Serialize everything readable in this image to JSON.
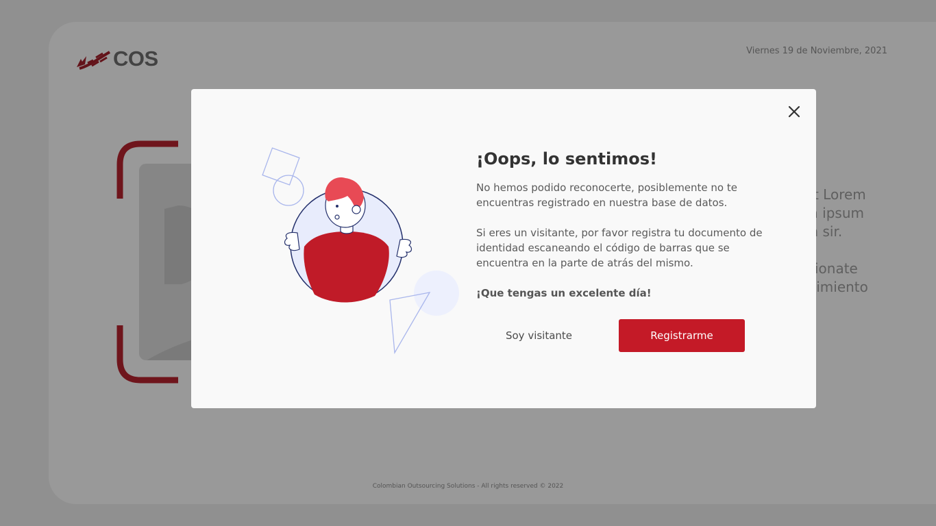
{
  "brand": {
    "logo_text": "COS"
  },
  "header": {
    "date": "Viernes 19 de Noviembre, 2021"
  },
  "background_text": {
    "paragraph1": [
      "net Lorem",
      "em ipsum",
      "um sir."
    ],
    "paragraph2": [
      "sicionate",
      "nicimiento"
    ]
  },
  "footer": {
    "text": "Colombian Outsourcing Solutions - All rights reserved © 2022"
  },
  "modal": {
    "title": "¡Oops, lo sentimos!",
    "message1": "No hemos podido reconocerte, posiblemente no te encuentras registrado en nuestra base de datos.",
    "message2": "Si eres un visitante, por favor registra tu documento de identidad escaneando el código de barras que se encuentra en la parte de atrás del mismo.",
    "message3": "¡Que tengas un excelente día!",
    "visitor_button": "Soy visitante",
    "register_button": "Registrarme"
  },
  "colors": {
    "accent": "#c41a27",
    "overlay": "rgba(0,0,0,0.38)"
  }
}
